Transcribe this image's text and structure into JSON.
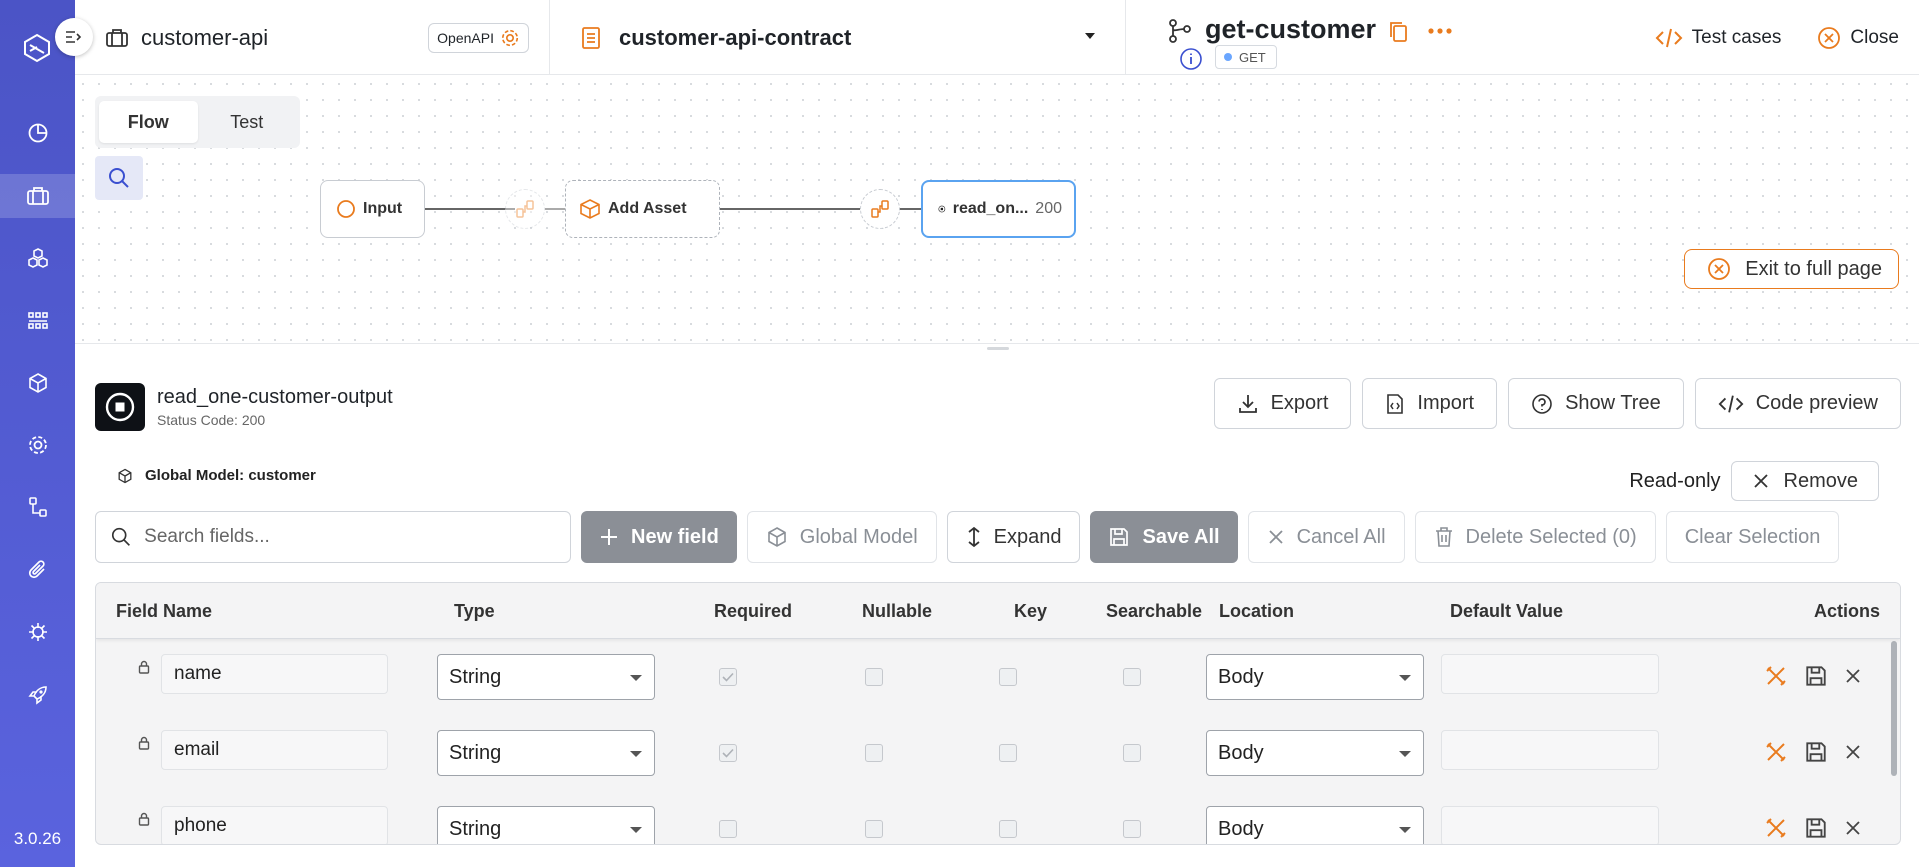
{
  "app": {
    "version": "3.0.26"
  },
  "header": {
    "project_name": "customer-api",
    "openapi_label": "OpenAPI",
    "contract_name": "customer-api-contract",
    "operation_name": "get-customer",
    "method": "GET",
    "test_cases_label": "Test cases",
    "close_label": "Close"
  },
  "canvas": {
    "tabs": [
      "Flow",
      "Test"
    ],
    "active_tab": "Flow",
    "nodes": {
      "input": "Input",
      "asset": "Add Asset",
      "output": "read_on...",
      "output_code": "200"
    },
    "exit_full_page": "Exit to full page"
  },
  "panel": {
    "title": "read_one-customer-output",
    "subtitle": "Status Code: 200",
    "actions": {
      "export": "Export",
      "import": "Import",
      "show_tree": "Show Tree",
      "code_preview": "Code preview"
    },
    "global_model_label": "Global Model: customer",
    "read_only": "Read-only",
    "remove": "Remove"
  },
  "toolbar": {
    "search_placeholder": "Search fields...",
    "new_field": "New field",
    "global_model": "Global Model",
    "expand": "Expand",
    "save_all": "Save All",
    "cancel_all": "Cancel All",
    "delete_selected": "Delete Selected (0)",
    "clear_selection": "Clear Selection"
  },
  "table": {
    "columns": [
      "Field Name",
      "Type",
      "Required",
      "Nullable",
      "Key",
      "Searchable",
      "Location",
      "Default Value",
      "Actions"
    ],
    "rows": [
      {
        "name": "name",
        "type": "String",
        "required": true,
        "nullable": false,
        "key": false,
        "searchable": false,
        "location": "Body",
        "default": ""
      },
      {
        "name": "email",
        "type": "String",
        "required": true,
        "nullable": false,
        "key": false,
        "searchable": false,
        "location": "Body",
        "default": ""
      },
      {
        "name": "phone",
        "type": "String",
        "required": false,
        "nullable": false,
        "key": false,
        "searchable": false,
        "location": "Body",
        "default": ""
      }
    ]
  },
  "colors": {
    "accent": "#e97b1e",
    "sidebar": "#5058cf",
    "selected_node": "#5aa3f0"
  }
}
